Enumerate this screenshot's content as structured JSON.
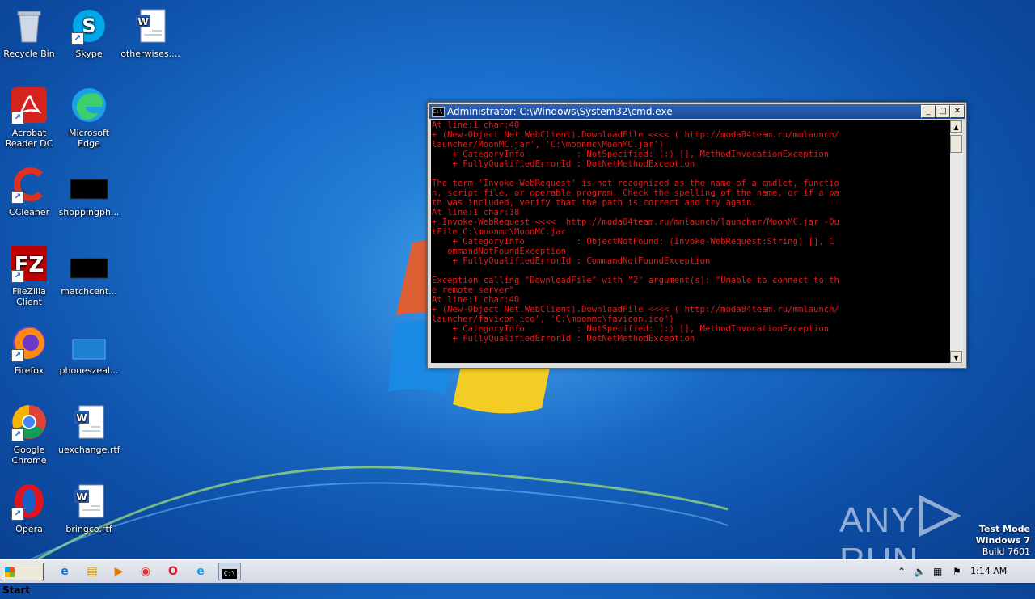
{
  "desktop": {
    "icons": [
      {
        "label": "Recycle Bin",
        "icon": "recycle-bin-icon"
      },
      {
        "label": "Skype",
        "icon": "skype-icon"
      },
      {
        "label": "otherwises....",
        "icon": "word-document-icon"
      },
      {
        "label": "Acrobat Reader DC",
        "icon": "acrobat-icon"
      },
      {
        "label": "Microsoft Edge",
        "icon": "edge-icon"
      },
      {
        "label": "CCleaner",
        "icon": "ccleaner-icon"
      },
      {
        "label": "shoppingph...",
        "icon": "black-file-icon"
      },
      {
        "label": "FileZilla Client",
        "icon": "filezilla-icon"
      },
      {
        "label": "matchcent...",
        "icon": "black-file-icon"
      },
      {
        "label": "Firefox",
        "icon": "firefox-icon"
      },
      {
        "label": "phoneszeal...",
        "icon": "blank-file-icon"
      },
      {
        "label": "Google Chrome",
        "icon": "chrome-icon"
      },
      {
        "label": "uexchange.rtf",
        "icon": "word-document-icon"
      },
      {
        "label": "Opera",
        "icon": "opera-icon"
      },
      {
        "label": "bringco.rtf",
        "icon": "word-document-icon"
      }
    ]
  },
  "cmd": {
    "title": "Administrator: C:\\Windows\\System32\\cmd.exe",
    "icon_text": "C:\\",
    "minimize": "_",
    "maximize": "□",
    "close": "✕",
    "output": "At line:1 char:40\n+ (New-Object Net.WebClient).DownloadFile <<<< ('http://moda84team.ru/mmlaunch/\nlauncher/MoonMC.jar', 'C:\\moonmc\\MoonMC.jar')\n    + CategoryInfo          : NotSpecified: (:) [], MethodInvocationException\n    + FullyQualifiedErrorId : DotNetMethodException\n\nThe term 'Invoke-WebRequest' is not recognized as the name of a cmdlet, functio\nn, script file, or operable program. Check the spelling of the name, or if a pa\nth was included, verify that the path is correct and try again.\nAt line:1 char:18\n+ Invoke-WebRequest <<<<  http://moda84team.ru/mmlaunch/launcher/MoonMC.jar -Ou\ntFile C:\\moonmc\\MoonMC.jar\n    + CategoryInfo          : ObjectNotFound: (Invoke-WebRequest:String) [], C\n   ommandNotFoundException\n    + FullyQualifiedErrorId : CommandNotFoundException\n\nException calling \"DownloadFile\" with \"2\" argument(s): \"Unable to connect to th\ne remote server\"\nAt line:1 char:40\n+ (New-Object Net.WebClient).DownloadFile <<<< ('http://moda84team.ru/mmlaunch/\nlauncher/favicon.ico', 'C:\\moonmc\\favicon.ico')\n    + CategoryInfo          : NotSpecified: (:) [], MethodInvocationException\n    + FullyQualifiedErrorId : DotNetMethodException",
    "colors": {
      "text": "#e41b1b",
      "background": "#000000"
    }
  },
  "watermark": {
    "brand_left": "ANY",
    "brand_right": "RUN",
    "mode": "Test Mode",
    "os": "Windows 7",
    "build": "Build 7601"
  },
  "taskbar": {
    "start_label": "Start",
    "items": [
      {
        "name": "ie-icon",
        "glyph": "e"
      },
      {
        "name": "explorer-icon",
        "glyph": "▤"
      },
      {
        "name": "media-player-icon",
        "glyph": "▶"
      },
      {
        "name": "chrome-icon",
        "glyph": "◉"
      },
      {
        "name": "opera-icon",
        "glyph": "O"
      },
      {
        "name": "edge-icon",
        "glyph": "e"
      },
      {
        "name": "cmd-icon",
        "glyph": "C:\\"
      }
    ],
    "tray_arrow": "⌃",
    "clock": "1:14 AM"
  }
}
